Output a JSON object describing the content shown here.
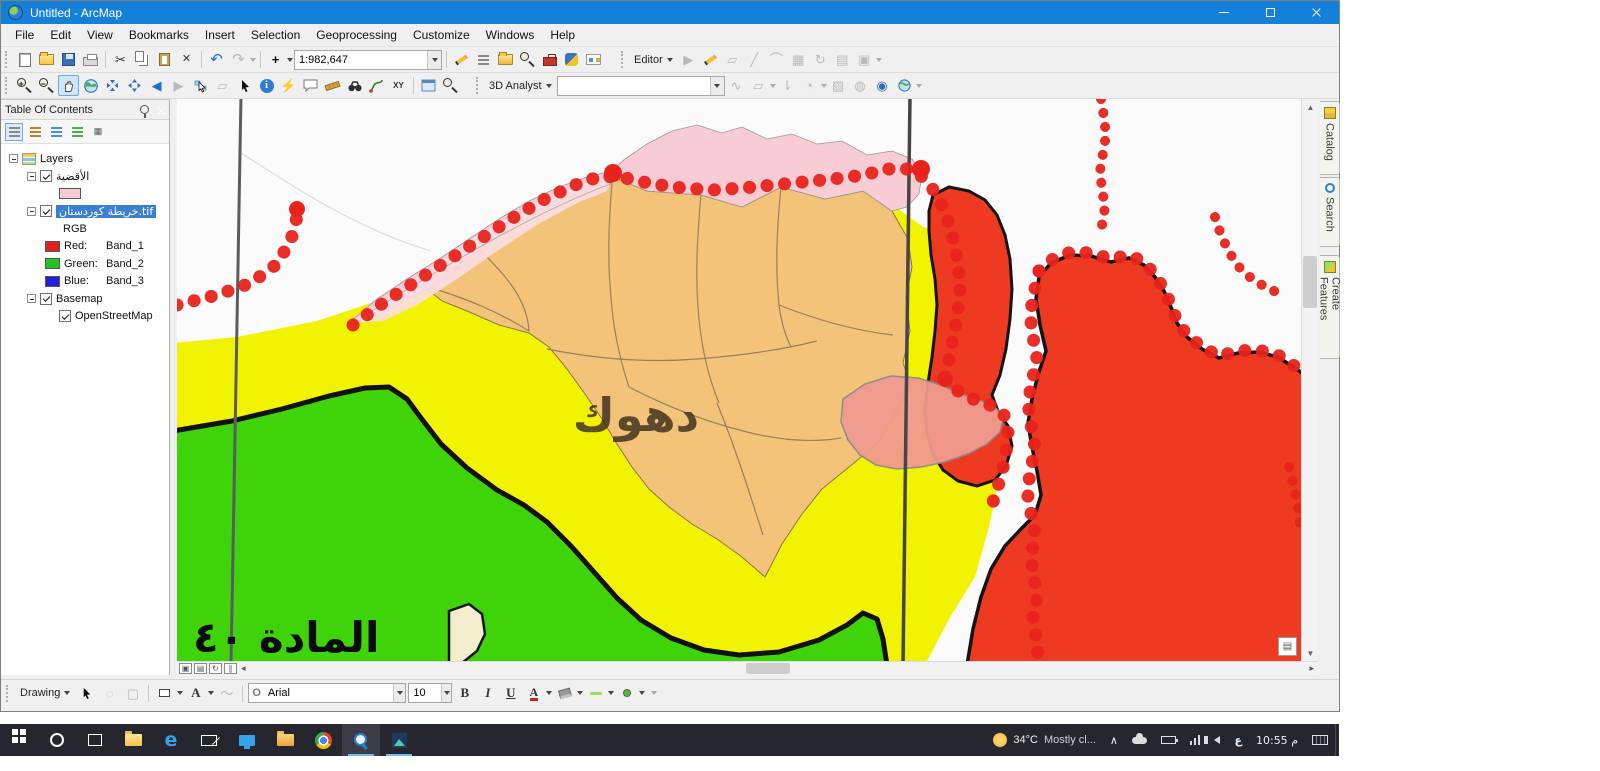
{
  "window": {
    "title": "Untitled - ArcMap"
  },
  "menu": {
    "items": [
      "File",
      "Edit",
      "View",
      "Bookmarks",
      "Insert",
      "Selection",
      "Geoprocessing",
      "Customize",
      "Windows",
      "Help"
    ]
  },
  "std": {
    "scale": "1:982,647",
    "editor": "Editor"
  },
  "tools": {
    "analyst": "3D Analyst",
    "layer_combo": ""
  },
  "toc": {
    "title": "Table Of Contents",
    "root": "Layers",
    "layer_districts": "الأقضية",
    "layer_raster": "خريطة كوردستان.tif",
    "rgb": "RGB",
    "band_red_label": "Red:",
    "band_red_value": "Band_1",
    "band_green_label": "Green:",
    "band_green_value": "Band_2",
    "band_blue_label": "Blue:",
    "band_blue_value": "Band_3",
    "basemap": "Basemap",
    "osm": "OpenStreetMap"
  },
  "map": {
    "label_duhok": "دهوك",
    "label_article": "المادة ٤٠",
    "colors": {
      "green": "#3fd30a",
      "yellow": "#f2f303",
      "tan": "#f2c379",
      "pink": "#f8ccd4",
      "light_pink": "#fbdee4",
      "red": "#ee3a20",
      "salmon": "#f09a90",
      "chain": "#e8231c"
    }
  },
  "dock": {
    "catalog": "Catalog",
    "search": "Search",
    "create": "Create Features"
  },
  "draw": {
    "label": "Drawing",
    "font": "Arial",
    "size": "10",
    "bold": "B",
    "italic": "I",
    "underline": "U"
  },
  "task": {
    "temp": "34°C",
    "desc": "Mostly cl...",
    "lang": "ع",
    "time": "10:55 م"
  },
  "icons": {
    "caret": "▾",
    "scissors": "✂",
    "undo": "↶",
    "redo": "↷",
    "back": "◀",
    "forward": "▶",
    "refresh": "↻",
    "pause": "∥",
    "up": "▲",
    "down": "▼",
    "left": "◂",
    "right": "▸",
    "chevron_hidden": "∧",
    "plus": "+",
    "lightning": "⚡",
    "xy": "XY",
    "delete": "✕",
    "page": "▤"
  }
}
